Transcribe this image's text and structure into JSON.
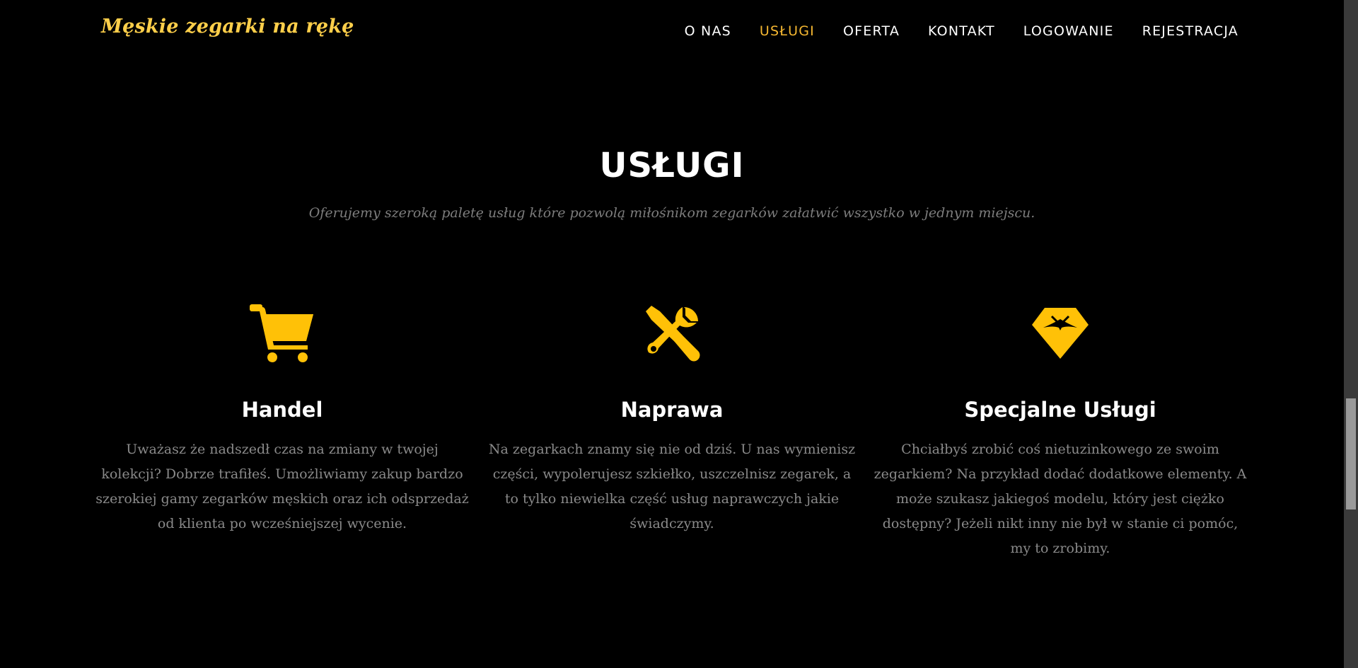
{
  "brand": {
    "name": "Męskie zegarki na rękę"
  },
  "nav": {
    "items": [
      {
        "label": "O NAS",
        "active": false
      },
      {
        "label": "USŁUGI",
        "active": true
      },
      {
        "label": "OFERTA",
        "active": false
      },
      {
        "label": "KONTAKT",
        "active": false
      },
      {
        "label": "LOGOWANIE",
        "active": false
      },
      {
        "label": "REJESTRACJA",
        "active": false
      }
    ]
  },
  "section": {
    "title": "USŁUGI",
    "subtitle": "Oferujemy szeroką paletę usług które pozwolą miłośnikom zegarków załatwić wszystko w jednym miejscu."
  },
  "services": [
    {
      "icon": "cart-icon",
      "title": "Handel",
      "text": "Uważasz że nadszedł czas na zmiany w twojej kolekcji? Dobrze trafiłeś. Umożliwiamy zakup bardzo szerokiej gamy zegarków męskich oraz ich odsprzedaż od klienta po wcześniejszej wycenie."
    },
    {
      "icon": "tools-icon",
      "title": "Naprawa",
      "text": "Na zegarkach znamy się nie od dziś. U nas wymienisz części, wypolerujesz szkiełko, uszczelnisz zegarek, a to tylko niewielka część usług naprawczych jakie świadczymy."
    },
    {
      "icon": "diamond-icon",
      "title": "Specjalne Usługi",
      "text": "Chciałbyś zrobić coś nietuzinkowego ze swoim zegarkiem? Na przykład dodać dodatkowe elementy. A może szukasz jakiegoś modelu, który jest ciężko dostępny? Jeżeli nikt inny nie był w stanie ci pomóc, my to zrobimy."
    }
  ],
  "colors": {
    "background": "#000000",
    "accent": "#ffc107",
    "brand": "#ffcf4a",
    "nav_active": "#f5b731",
    "heading": "#ffffff",
    "body_text": "#8a8a8a"
  }
}
